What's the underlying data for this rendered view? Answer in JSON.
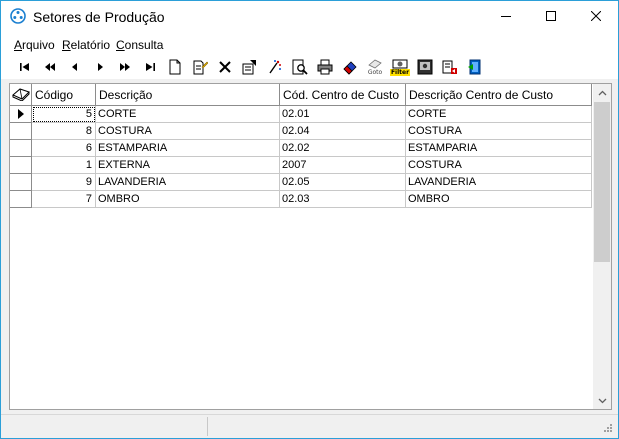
{
  "window": {
    "title": "Setores de Produção"
  },
  "menu": {
    "items": [
      {
        "underline": "A",
        "rest": "rquivo"
      },
      {
        "underline": "R",
        "rest": "elatório"
      },
      {
        "underline": "C",
        "rest": "onsulta"
      }
    ]
  },
  "toolbar": {
    "buttons": [
      {
        "icon": "first-record-icon"
      },
      {
        "icon": "prior-page-icon"
      },
      {
        "icon": "prior-record-icon"
      },
      {
        "icon": "next-record-icon"
      },
      {
        "icon": "next-page-icon"
      },
      {
        "icon": "last-record-icon"
      },
      {
        "icon": "new-record-icon"
      },
      {
        "icon": "edit-record-icon"
      },
      {
        "icon": "delete-record-icon"
      },
      {
        "icon": "properties-icon"
      },
      {
        "icon": "refresh-icon"
      },
      {
        "icon": "preview-icon"
      },
      {
        "icon": "print-icon"
      },
      {
        "icon": "clear-icon"
      },
      {
        "icon": "goto-icon",
        "label": "Goto"
      },
      {
        "icon": "filter-icon",
        "label": "Filter"
      },
      {
        "icon": "picture-icon"
      },
      {
        "icon": "export-icon"
      },
      {
        "icon": "exit-icon"
      }
    ]
  },
  "grid": {
    "columns": [
      "Código",
      "Descrição",
      "Cód. Centro de Custo",
      "Descrição Centro de Custo"
    ],
    "rows": [
      {
        "codigo": "5",
        "descricao": "CORTE",
        "cod_centro": "02.01",
        "desc_centro": "CORTE"
      },
      {
        "codigo": "8",
        "descricao": "COSTURA",
        "cod_centro": "02.04",
        "desc_centro": "COSTURA"
      },
      {
        "codigo": "6",
        "descricao": "ESTAMPARIA",
        "cod_centro": "02.02",
        "desc_centro": "ESTAMPARIA"
      },
      {
        "codigo": "1",
        "descricao": "EXTERNA",
        "cod_centro": "2007",
        "desc_centro": "COSTURA"
      },
      {
        "codigo": "9",
        "descricao": "LAVANDERIA",
        "cod_centro": "02.05",
        "desc_centro": "LAVANDERIA"
      },
      {
        "codigo": "7",
        "descricao": "OMBRO",
        "cod_centro": "02.03",
        "desc_centro": "OMBRO"
      }
    ]
  }
}
